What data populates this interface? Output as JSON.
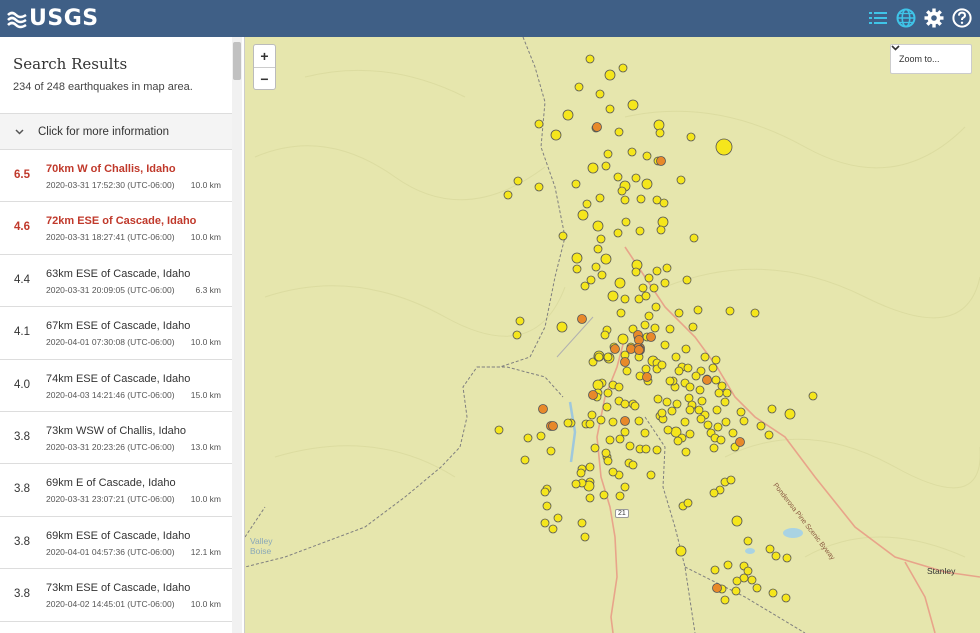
{
  "header": {
    "logo_text": "USGS",
    "bg_color": "#3f5f86"
  },
  "toolbar": {
    "list_icon": "list-icon",
    "globe_icon": "globe-icon",
    "settings_icon": "gear-icon",
    "help_icon": "help-icon",
    "accent_color": "#3fc4e8"
  },
  "sidebar": {
    "title": "Search Results",
    "count_text": "234 of 248 earthquakes in map area.",
    "more_info_label": "Click for more information"
  },
  "quakes": [
    {
      "mag": "6.5",
      "place": "70km W of Challis, Idaho",
      "time": "2020-03-31 17:52:30 (UTC-06:00)",
      "depth": "10.0 km",
      "highlight": true
    },
    {
      "mag": "4.6",
      "place": "72km ESE of Cascade, Idaho",
      "time": "2020-03-31 18:27:41 (UTC-06:00)",
      "depth": "10.0 km",
      "highlight": true
    },
    {
      "mag": "4.4",
      "place": "63km ESE of Cascade, Idaho",
      "time": "2020-03-31 20:09:05 (UTC-06:00)",
      "depth": "6.3 km"
    },
    {
      "mag": "4.1",
      "place": "67km ESE of Cascade, Idaho",
      "time": "2020-04-01 07:30:08 (UTC-06:00)",
      "depth": "10.0 km"
    },
    {
      "mag": "4.0",
      "place": "74km ESE of Cascade, Idaho",
      "time": "2020-04-03 14:21:46 (UTC-06:00)",
      "depth": "15.0 km"
    },
    {
      "mag": "3.8",
      "place": "73km WSW of Challis, Idaho",
      "time": "2020-03-31 20:23:26 (UTC-06:00)",
      "depth": "13.0 km"
    },
    {
      "mag": "3.8",
      "place": "69km E of Cascade, Idaho",
      "time": "2020-03-31 23:07:21 (UTC-06:00)",
      "depth": "10.0 km"
    },
    {
      "mag": "3.8",
      "place": "69km ESE of Cascade, Idaho",
      "time": "2020-04-01 04:57:36 (UTC-06:00)",
      "depth": "12.1 km"
    },
    {
      "mag": "3.8",
      "place": "73km ESE of Cascade, Idaho",
      "time": "2020-04-02 14:45:01 (UTC-06:00)",
      "depth": "10.0 km"
    }
  ],
  "map": {
    "zoom_in": "+",
    "zoom_out": "−",
    "zoom_to_label": "Zoom to...",
    "labels": {
      "valley": "Valley",
      "boise": "Boise",
      "stanley": "Stanley",
      "route": "21",
      "scenic_byway": "Ponderosa Pine Scenic Byway"
    },
    "marker_colors": {
      "recent": "#f5e61c",
      "older": "#e8892a",
      "stroke": "#555"
    }
  }
}
